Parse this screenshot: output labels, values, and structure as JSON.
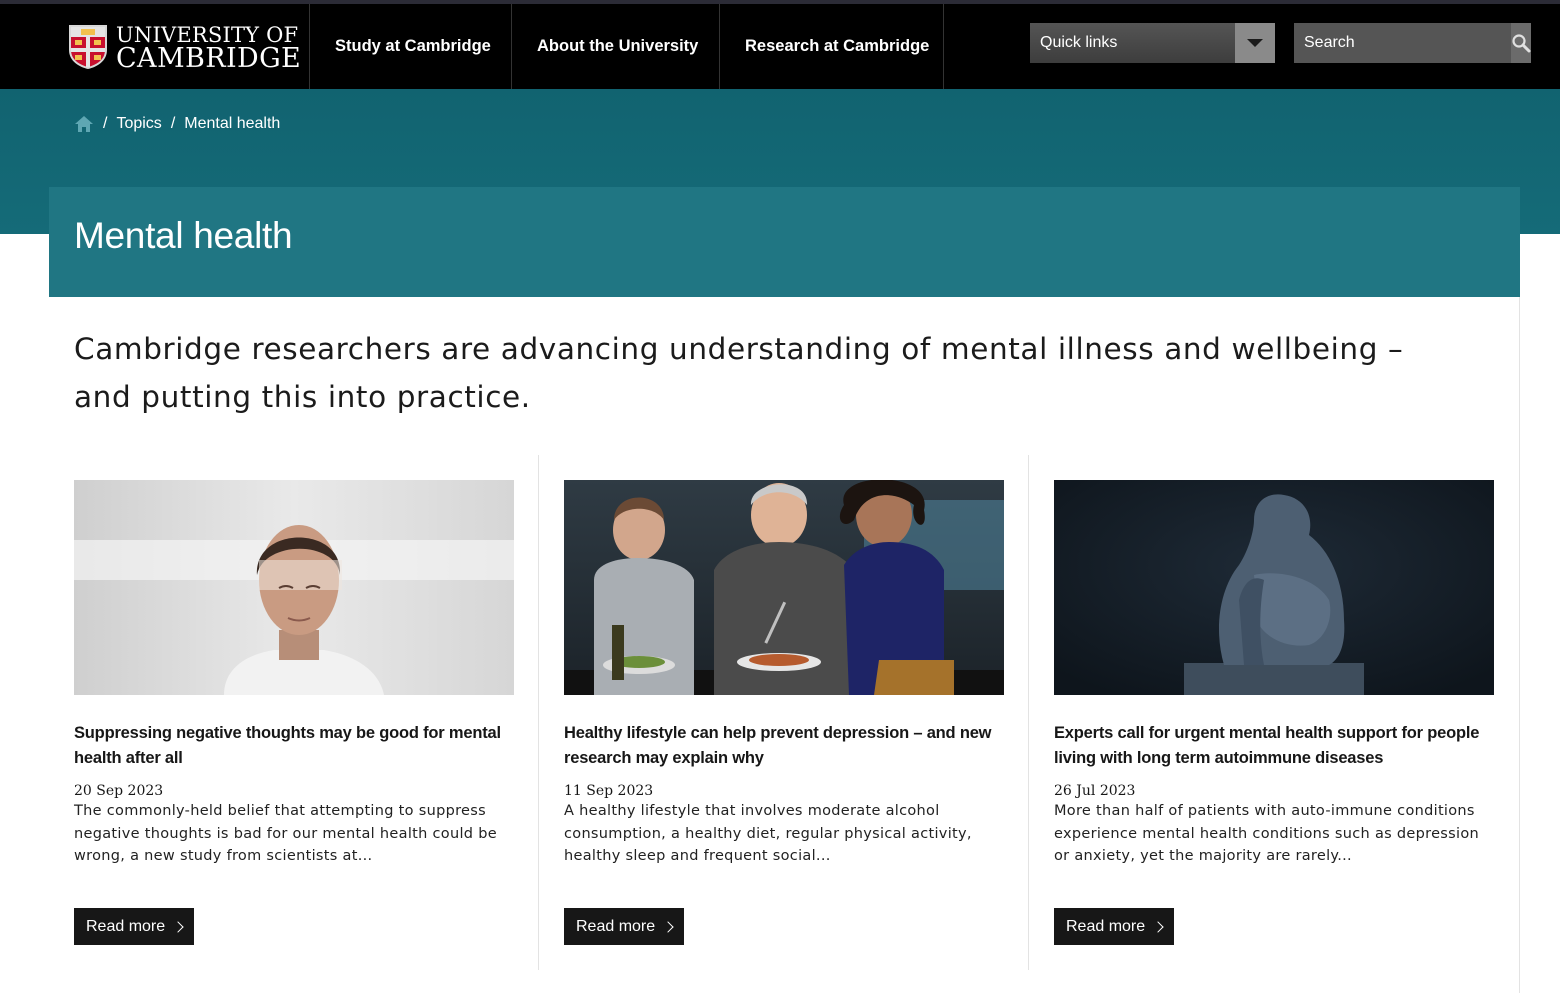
{
  "header": {
    "logo_line1": "UNIVERSITY OF",
    "logo_line2": "CAMBRIDGE",
    "nav": [
      "Study at Cambridge",
      "About the University",
      "Research at Cambridge"
    ],
    "quick_links_label": "Quick links",
    "search_placeholder": "Search"
  },
  "breadcrumb": {
    "home_icon": "home-icon",
    "items": [
      "Topics",
      "Mental health"
    ]
  },
  "page": {
    "title": "Mental health",
    "intro": "Cambridge researchers are advancing understanding of mental illness and wellbeing – and putting this into practice."
  },
  "cards": [
    {
      "title": "Suppressing negative thoughts may be good for mental health after all",
      "date": "20 Sep 2023",
      "excerpt": "The commonly-held belief that attempting to suppress negative thoughts is bad for our mental health could be wrong, a new study from scientists at...",
      "button": "Read more"
    },
    {
      "title": "Healthy lifestyle can help prevent depression – and new research may explain why",
      "date": "11 Sep 2023",
      "excerpt": "A healthy lifestyle that involves moderate alcohol consumption, a healthy diet, regular physical activity, healthy sleep and frequent social...",
      "button": "Read more"
    },
    {
      "title": "Experts call for urgent mental health support for people living with long term autoimmune diseases",
      "date": "26 Jul 2023",
      "excerpt": "More than half of patients with auto-immune conditions experience mental health conditions such as depression or anxiety, yet the majority are rarely...",
      "button": "Read more"
    }
  ],
  "colors": {
    "header_bg": "#000000",
    "teal_band": "#116370",
    "hero_bg": "#207683",
    "button_bg": "#171717"
  }
}
